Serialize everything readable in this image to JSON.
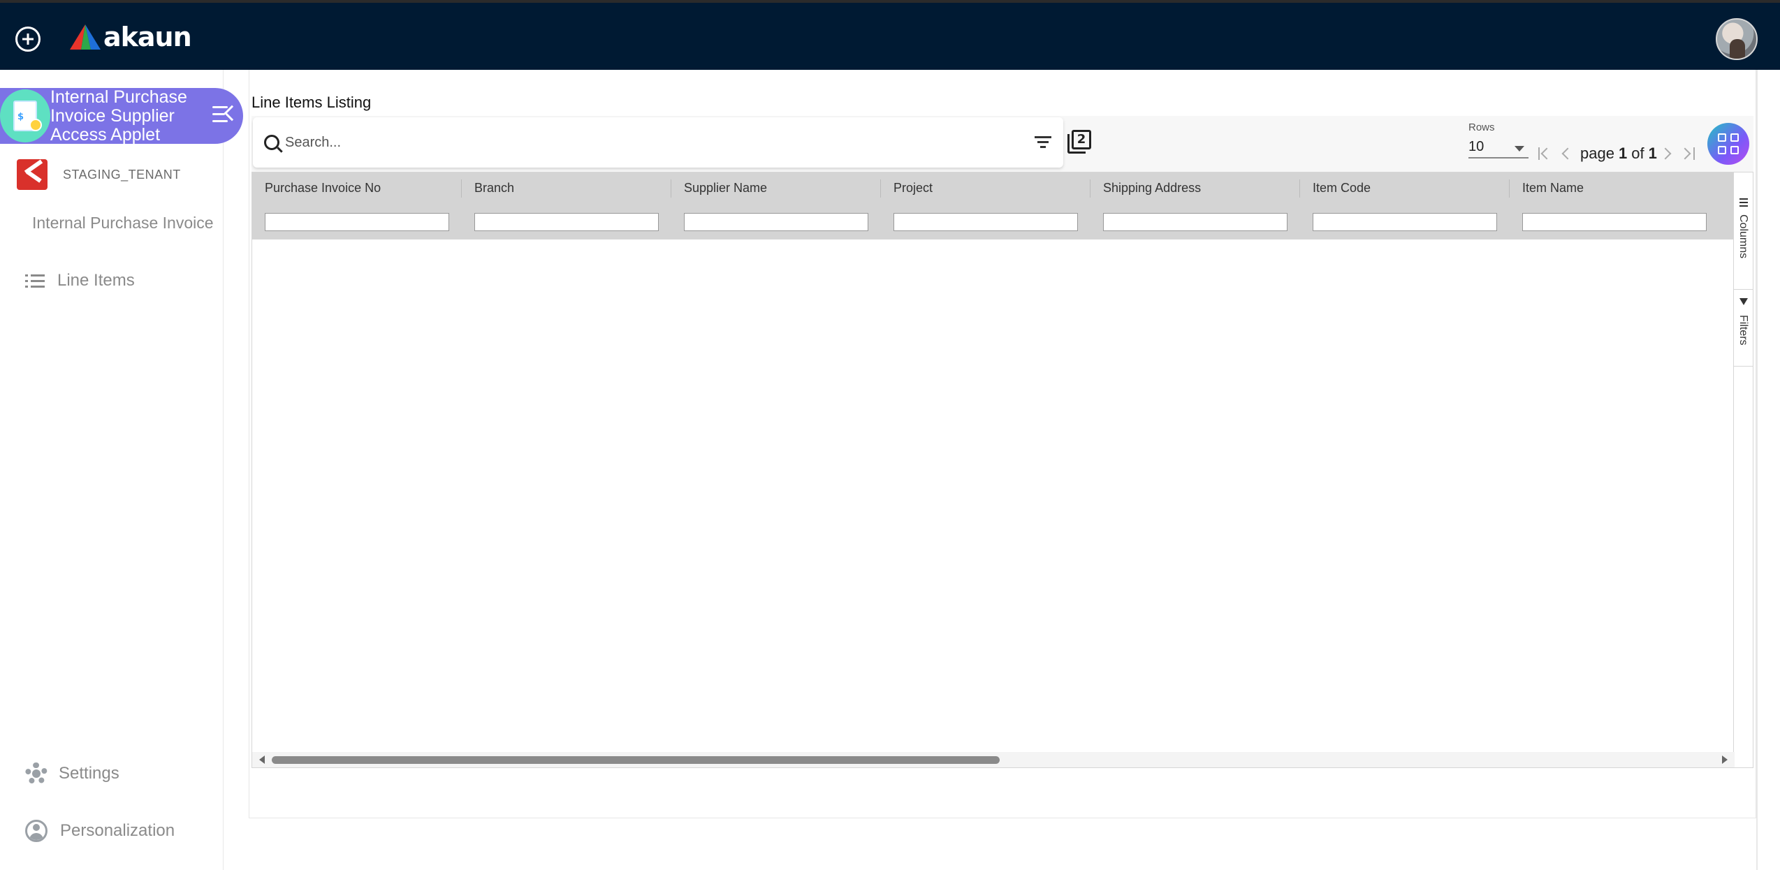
{
  "topbar": {
    "brand": "akaun",
    "colors": {
      "background": "#001a33",
      "logo_red": "#e8342b",
      "logo_green": "#2ea84a",
      "logo_blue": "#1e6fd9"
    }
  },
  "sidebar": {
    "applet_title": "Internal Purchase Invoice Supplier Access Applet",
    "tenant": "STAGING_TENANT",
    "sub_item": "Internal Purchase Invoice",
    "items": [
      {
        "label": "Line Items",
        "icon": "list-icon"
      }
    ],
    "footer": [
      {
        "label": "Settings",
        "icon": "gear-icon"
      },
      {
        "label": "Personalization",
        "icon": "person-icon"
      }
    ],
    "colors": {
      "applet_banner": "#7c73e6"
    }
  },
  "main": {
    "listing_title": "Line Items Listing",
    "search": {
      "placeholder": "Search...",
      "value": ""
    },
    "rows": {
      "label": "Rows",
      "value": "10"
    },
    "pager": {
      "page_word": "page",
      "current": "1",
      "of_word": "of",
      "total": "1"
    },
    "copy_badge": "2",
    "columns": [
      "Purchase Invoice No",
      "Branch",
      "Supplier Name",
      "Project",
      "Shipping Address",
      "Item Code",
      "Item Name"
    ],
    "side_tabs": {
      "columns": "Columns",
      "filters": "Filters"
    }
  }
}
